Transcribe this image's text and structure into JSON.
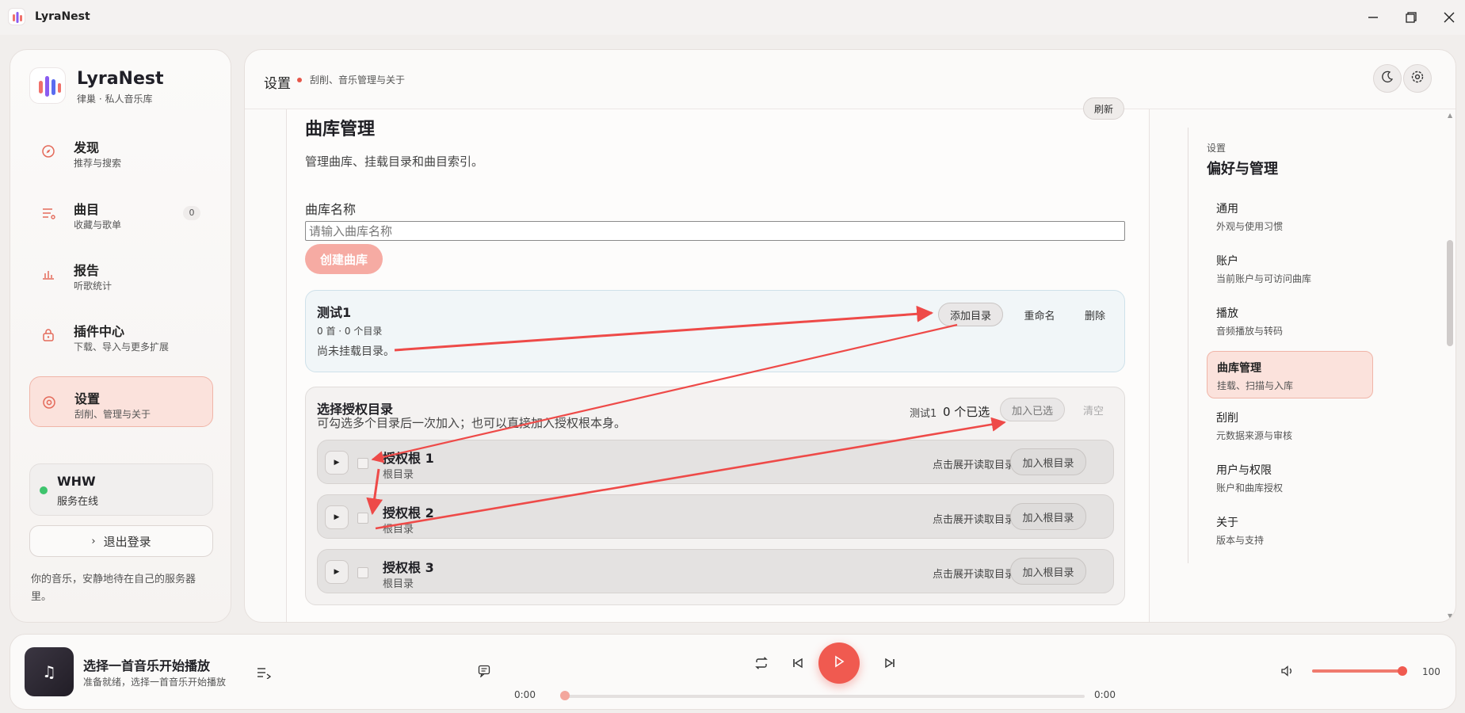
{
  "window": {
    "title": "LyraNest"
  },
  "brand": {
    "name": "LyraNest",
    "subtitle": "律巢 · 私人音乐库"
  },
  "nav": [
    {
      "label": "发现",
      "sub": "推荐与搜索",
      "icon": "compass-icon"
    },
    {
      "label": "曲目",
      "sub": "收藏与歌单",
      "icon": "playlist-icon",
      "badge": "0"
    },
    {
      "label": "报告",
      "sub": "听歌统计",
      "icon": "bar-chart-icon"
    },
    {
      "label": "插件中心",
      "sub": "下载、导入与更多扩展",
      "icon": "plugin-lock-icon"
    },
    {
      "label": "设置",
      "sub": "刮削、管理与关于",
      "icon": "settings-icon",
      "active": true
    }
  ],
  "user": {
    "name": "WHW",
    "status": "服务在线",
    "logout_label": "退出登录"
  },
  "tagline": "你的音乐，安静地待在自己的服务器里。",
  "header": {
    "title": "设置",
    "subtitle": "刮削、音乐管理与关于"
  },
  "section": {
    "refresh_label": "刷新",
    "title": "曲库管理",
    "description": "管理曲库、挂载目录和曲目索引。",
    "name_label": "曲库名称",
    "name_placeholder": "请输入曲库名称",
    "create_label": "创建曲库"
  },
  "library": {
    "name": "测试1",
    "meta": "0 首 · 0 个目录",
    "empty": "尚未挂载目录。",
    "add_dir_label": "添加目录",
    "rename_label": "重命名",
    "delete_label": "删除"
  },
  "auth": {
    "title": "选择授权目录",
    "description": "可勾选多个目录后一次加入；也可以直接加入授权根本身。",
    "library": "测试1",
    "selected_count": "0 个已选",
    "add_selected_label": "加入已选",
    "clear_label": "清空",
    "roots": [
      {
        "name": "授权根 1",
        "sub": "根目录",
        "hint": "点击展开读取目录",
        "add_label": "加入根目录"
      },
      {
        "name": "授权根 2",
        "sub": "根目录",
        "hint": "点击展开读取目录",
        "add_label": "加入根目录"
      },
      {
        "name": "授权根 3",
        "sub": "根目录",
        "hint": "点击展开读取目录",
        "add_label": "加入根目录"
      }
    ]
  },
  "right_nav": {
    "kicker": "设置",
    "title": "偏好与管理",
    "items": [
      {
        "label": "通用",
        "sub": "外观与使用习惯"
      },
      {
        "label": "账户",
        "sub": "当前账户与可访问曲库"
      },
      {
        "label": "播放",
        "sub": "音频播放与转码"
      },
      {
        "label": "曲库管理",
        "sub": "挂载、扫描与入库",
        "active": true
      },
      {
        "label": "刮削",
        "sub": "元数据来源与审核"
      },
      {
        "label": "用户与权限",
        "sub": "账户和曲库授权"
      },
      {
        "label": "关于",
        "sub": "版本与支持"
      }
    ]
  },
  "player": {
    "title": "选择一首音乐开始播放",
    "subtitle": "准备就绪，选择一首音乐开始播放",
    "time_current": "0:00",
    "time_total": "0:00",
    "progress": 0,
    "volume": 100,
    "volume_label": "100"
  },
  "colors": {
    "accent": "#f05a50",
    "active_bg": "#fbe2dc",
    "arrow": "#ee4a48"
  }
}
